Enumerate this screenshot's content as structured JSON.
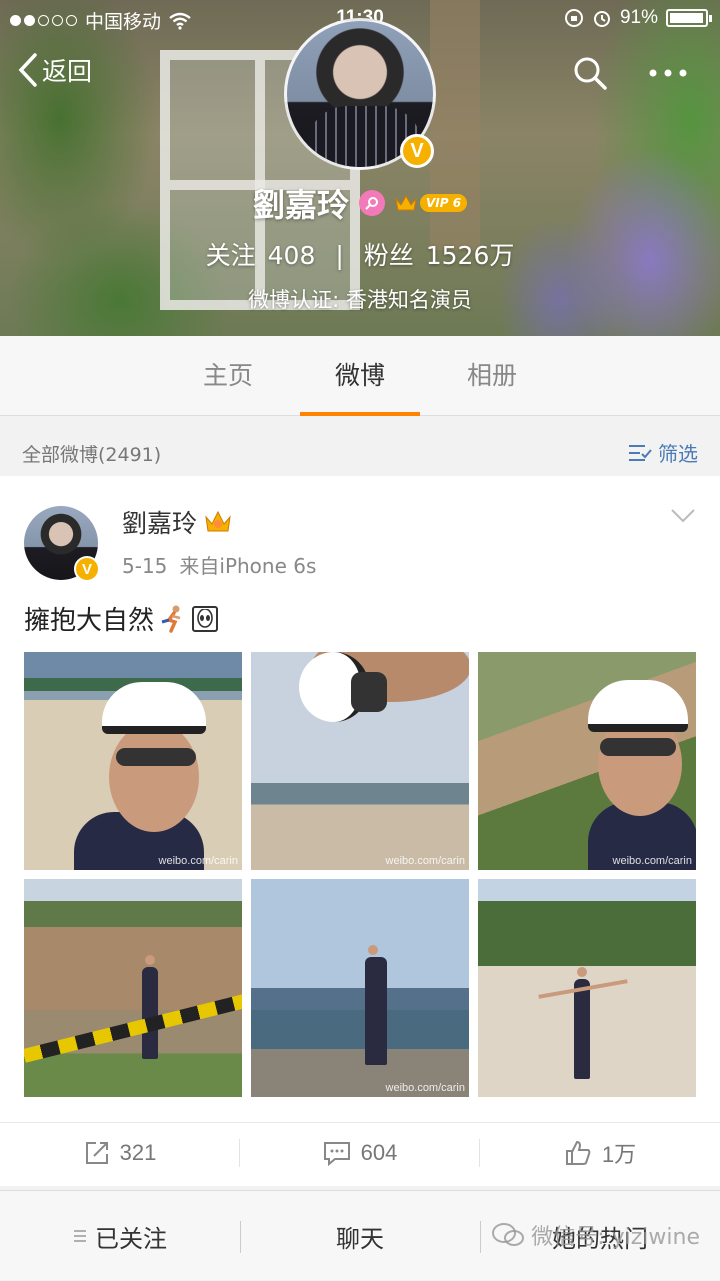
{
  "status_bar": {
    "carrier": "中国移动",
    "time": "11:30",
    "battery": "91%"
  },
  "nav": {
    "back_label": "返回"
  },
  "profile": {
    "name": "劉嘉玲",
    "vip_label": "VIP 6",
    "following_label": "关注",
    "following_count": "408",
    "separator": "|",
    "followers_label": "粉丝",
    "followers_count": "1526万",
    "verification": "微博认证: 香港知名演员"
  },
  "tabs": [
    {
      "label": "主页"
    },
    {
      "label": "微博"
    },
    {
      "label": "相册"
    }
  ],
  "filter_bar": {
    "count_label": "全部微博(2491)",
    "filter_label": "筛选"
  },
  "post": {
    "author": "劉嘉玲",
    "date": "5-15",
    "source": "来自iPhone 6s",
    "text": "擁抱大自然",
    "watermark": "weibo.com/carin",
    "repost_count": "321",
    "comment_count": "604",
    "like_count": "1万"
  },
  "bottom_bar": {
    "following_label": "已关注",
    "chat_label": "聊天",
    "hot_label": "她的热门",
    "overlay_watermark": "微信号: yiziwine"
  },
  "colors": {
    "accent": "#ff8200",
    "link": "#4a7bb7",
    "verified": "#f6b100"
  }
}
